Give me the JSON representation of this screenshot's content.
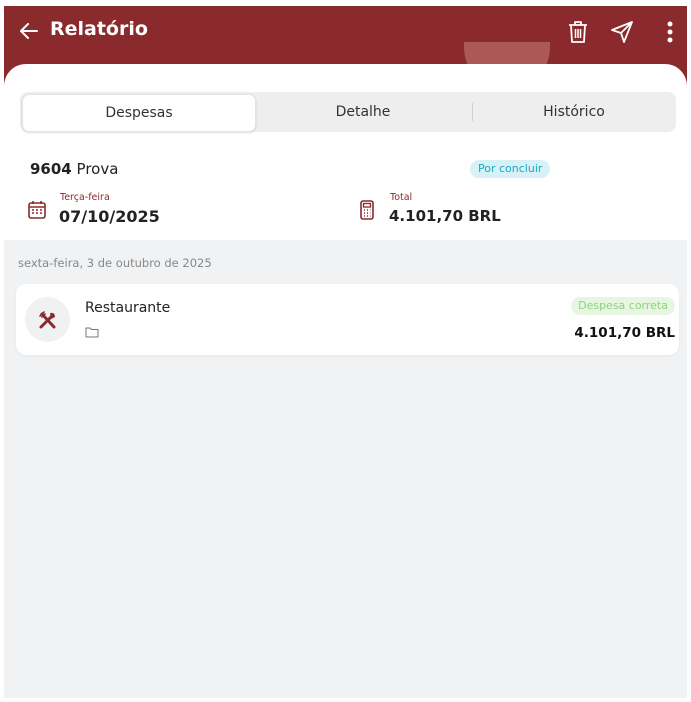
{
  "appbar": {
    "title": "Relatório",
    "accent_color": "#8a2a2c"
  },
  "tabs": [
    {
      "label": "Despesas",
      "active": true
    },
    {
      "label": "Detalhe",
      "active": false
    },
    {
      "label": "Histórico",
      "active": false
    }
  ],
  "report": {
    "number": "9604",
    "name": "Prova",
    "status": "Por concluir",
    "date_label": "Terça-feira",
    "date_value": "07/10/2025",
    "total_label": "Total",
    "total_value": "4.101,70 BRL"
  },
  "list": {
    "date_header": "sexta-feira, 3 de outubro de 2025",
    "items": [
      {
        "category": "Restaurante",
        "status": "Despesa correta",
        "amount": "4.101,70 BRL",
        "icon": "fork-knife-icon",
        "status_color": "#8ed37c"
      }
    ]
  }
}
